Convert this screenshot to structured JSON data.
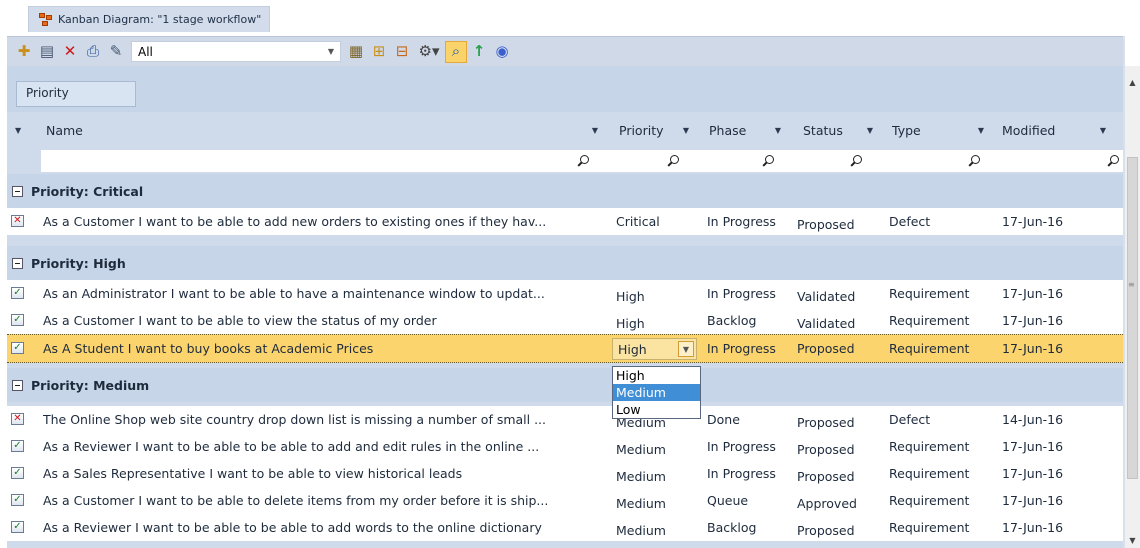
{
  "window": {
    "title": "Kanban Diagram: \"1 stage workflow\""
  },
  "toolbar": {
    "icons": [
      "new-element-icon",
      "properties-icon",
      "delete-icon",
      "print-icon",
      "edit-icon"
    ],
    "filter_value": "All",
    "icons_right": [
      "element-list-icon",
      "group-icon",
      "hierarchy-icon",
      "settings-icon",
      "search-icon",
      "up-arrow-icon",
      "help-icon"
    ]
  },
  "grouping": {
    "chip_label": "Priority"
  },
  "columns": {
    "name": "Name",
    "priority": "Priority",
    "phase": "Phase",
    "status": "Status",
    "type": "Type",
    "modified": "Modified"
  },
  "groups": [
    {
      "label": "Priority: Critical",
      "rows": [
        {
          "icon": "defect",
          "name": "As a Customer I want to be able to add new orders to existing ones if they hav...",
          "priority": "Critical",
          "phase": "In Progress",
          "status": "Proposed",
          "type": "Defect",
          "modified": "17-Jun-16"
        }
      ]
    },
    {
      "label": "Priority: High",
      "rows": [
        {
          "icon": "requirement",
          "name": "As an Administrator I want to be able to have a maintenance window to updat...",
          "priority": "High",
          "phase": "In Progress",
          "status": "Validated",
          "type": "Requirement",
          "modified": "17-Jun-16"
        },
        {
          "icon": "requirement",
          "name": "As a Customer I want to be able to view the status of my order",
          "priority": "High",
          "phase": "Backlog",
          "status": "Validated",
          "type": "Requirement",
          "modified": "17-Jun-16"
        },
        {
          "icon": "requirement",
          "name": "As A Student I want to buy books at Academic Prices",
          "priority": "High",
          "phase": "In Progress",
          "status": "Proposed",
          "type": "Requirement",
          "modified": "17-Jun-16",
          "selected": true
        }
      ]
    },
    {
      "label": "Priority: Medium",
      "rows": [
        {
          "icon": "defect",
          "name": "The Online Shop web site country drop down list is missing a number of small ...",
          "priority": "Medium",
          "phase": "Done",
          "status": "Proposed",
          "type": "Defect",
          "modified": "14-Jun-16"
        },
        {
          "icon": "requirement",
          "name": "As a Reviewer I want to be able to be able to add and edit rules in the online ...",
          "priority": "Medium",
          "phase": "In Progress",
          "status": "Proposed",
          "type": "Requirement",
          "modified": "17-Jun-16"
        },
        {
          "icon": "requirement",
          "name": "As a Sales Representative I want to be able to view historical leads",
          "priority": "Medium",
          "phase": "In Progress",
          "status": "Proposed",
          "type": "Requirement",
          "modified": "17-Jun-16"
        },
        {
          "icon": "requirement",
          "name": "As a Customer I want to be able to delete items from my order before it is ship...",
          "priority": "Medium",
          "phase": "Queue",
          "status": "Approved",
          "type": "Requirement",
          "modified": "17-Jun-16"
        },
        {
          "icon": "requirement",
          "name": "As a Reviewer I want to be able to be able to add words to the online dictionary",
          "priority": "Medium",
          "phase": "Backlog",
          "status": "Proposed",
          "type": "Requirement",
          "modified": "17-Jun-16"
        }
      ]
    }
  ],
  "priority_dropdown": {
    "current": "High",
    "options": [
      "High",
      "Medium",
      "Low"
    ],
    "highlighted": "Medium"
  },
  "colors": {
    "selected_row": "#fcd46e",
    "group_band": "#c6d5e8",
    "dropdown_highlight": "#3f8ed6"
  }
}
